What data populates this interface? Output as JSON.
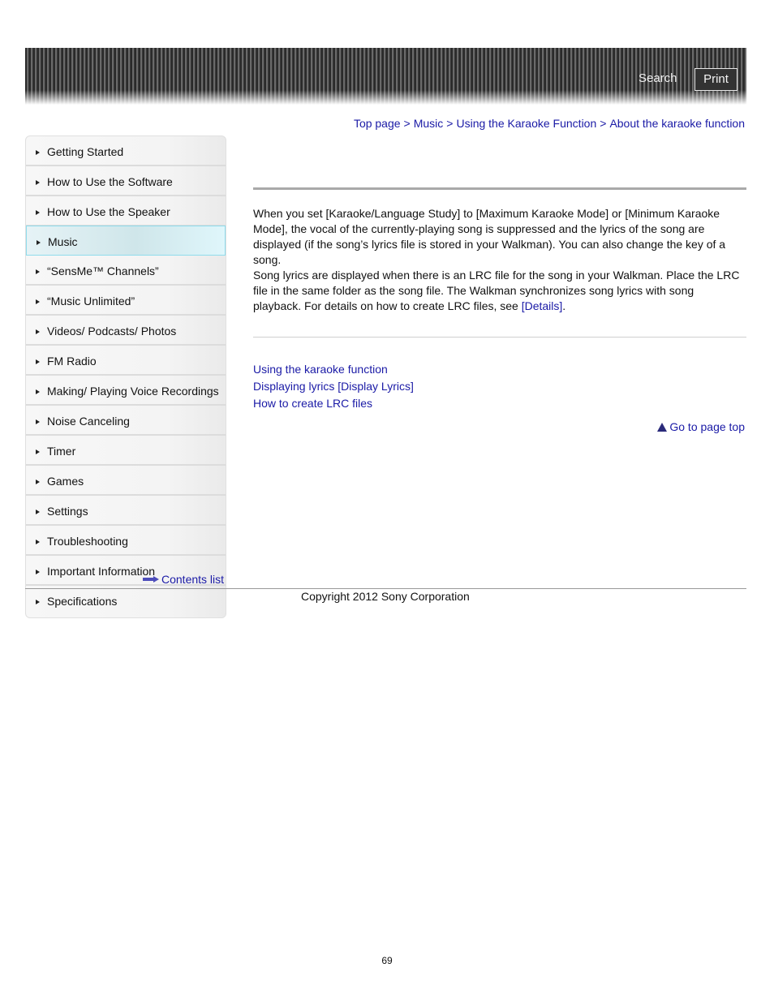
{
  "header": {
    "search_label": "Search",
    "print_label": "Print"
  },
  "breadcrumb": {
    "items": [
      "Top page",
      "Music",
      "Using the Karaoke Function",
      "About the karaoke function"
    ],
    "separator": ">"
  },
  "sidebar": {
    "items": [
      {
        "label": "Getting Started"
      },
      {
        "label": "How to Use the Software"
      },
      {
        "label": "How to Use the Speaker"
      },
      {
        "label": "Music",
        "active": true
      },
      {
        "label": "“SensMe™ Channels”"
      },
      {
        "label": "“Music Unlimited”"
      },
      {
        "label": "Videos/ Podcasts/ Photos"
      },
      {
        "label": "FM Radio"
      },
      {
        "label": "Making/ Playing Voice Recordings"
      },
      {
        "label": "Noise Canceling"
      },
      {
        "label": "Timer"
      },
      {
        "label": "Games"
      },
      {
        "label": "Settings"
      },
      {
        "label": "Troubleshooting"
      },
      {
        "label": "Important Information"
      },
      {
        "label": "Specifications"
      }
    ],
    "contents_list_label": "Contents list"
  },
  "main": {
    "paragraph1": "When you set [Karaoke/Language Study] to [Maximum Karaoke Mode] or [Minimum Karaoke Mode], the vocal of the currently-playing song is suppressed and the lyrics of the song are displayed (if the song’s lyrics file is stored in your Walkman). You can also change the key of a song.",
    "paragraph2_text": "Song lyrics are displayed when there is an LRC file for the song in your Walkman. Place the LRC file in the same folder as the song file. The Walkman synchronizes song lyrics with song playback. For details on how to create LRC files, see ",
    "paragraph2_link": "[Details]",
    "paragraph2_end": ".",
    "related_links": [
      "Using the karaoke function",
      "Displaying lyrics [Display Lyrics]",
      "How to create LRC files"
    ],
    "go_to_top_label": "Go to page top"
  },
  "footer": {
    "copyright": "Copyright 2012 Sony Corporation",
    "page_number": "69"
  },
  "colors": {
    "link": "#1a1aa6",
    "active_nav_border": "#8fdcec"
  }
}
